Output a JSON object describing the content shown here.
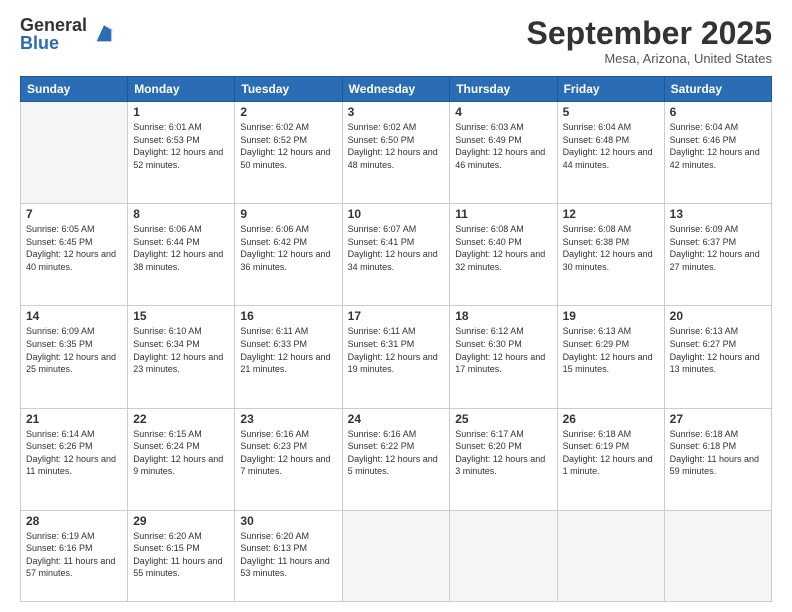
{
  "logo": {
    "general": "General",
    "blue": "Blue"
  },
  "header": {
    "month": "September 2025",
    "location": "Mesa, Arizona, United States"
  },
  "weekdays": [
    "Sunday",
    "Monday",
    "Tuesday",
    "Wednesday",
    "Thursday",
    "Friday",
    "Saturday"
  ],
  "weeks": [
    [
      {
        "day": "",
        "sunrise": "",
        "sunset": "",
        "daylight": ""
      },
      {
        "day": "1",
        "sunrise": "Sunrise: 6:01 AM",
        "sunset": "Sunset: 6:53 PM",
        "daylight": "Daylight: 12 hours and 52 minutes."
      },
      {
        "day": "2",
        "sunrise": "Sunrise: 6:02 AM",
        "sunset": "Sunset: 6:52 PM",
        "daylight": "Daylight: 12 hours and 50 minutes."
      },
      {
        "day": "3",
        "sunrise": "Sunrise: 6:02 AM",
        "sunset": "Sunset: 6:50 PM",
        "daylight": "Daylight: 12 hours and 48 minutes."
      },
      {
        "day": "4",
        "sunrise": "Sunrise: 6:03 AM",
        "sunset": "Sunset: 6:49 PM",
        "daylight": "Daylight: 12 hours and 46 minutes."
      },
      {
        "day": "5",
        "sunrise": "Sunrise: 6:04 AM",
        "sunset": "Sunset: 6:48 PM",
        "daylight": "Daylight: 12 hours and 44 minutes."
      },
      {
        "day": "6",
        "sunrise": "Sunrise: 6:04 AM",
        "sunset": "Sunset: 6:46 PM",
        "daylight": "Daylight: 12 hours and 42 minutes."
      }
    ],
    [
      {
        "day": "7",
        "sunrise": "Sunrise: 6:05 AM",
        "sunset": "Sunset: 6:45 PM",
        "daylight": "Daylight: 12 hours and 40 minutes."
      },
      {
        "day": "8",
        "sunrise": "Sunrise: 6:06 AM",
        "sunset": "Sunset: 6:44 PM",
        "daylight": "Daylight: 12 hours and 38 minutes."
      },
      {
        "day": "9",
        "sunrise": "Sunrise: 6:06 AM",
        "sunset": "Sunset: 6:42 PM",
        "daylight": "Daylight: 12 hours and 36 minutes."
      },
      {
        "day": "10",
        "sunrise": "Sunrise: 6:07 AM",
        "sunset": "Sunset: 6:41 PM",
        "daylight": "Daylight: 12 hours and 34 minutes."
      },
      {
        "day": "11",
        "sunrise": "Sunrise: 6:08 AM",
        "sunset": "Sunset: 6:40 PM",
        "daylight": "Daylight: 12 hours and 32 minutes."
      },
      {
        "day": "12",
        "sunrise": "Sunrise: 6:08 AM",
        "sunset": "Sunset: 6:38 PM",
        "daylight": "Daylight: 12 hours and 30 minutes."
      },
      {
        "day": "13",
        "sunrise": "Sunrise: 6:09 AM",
        "sunset": "Sunset: 6:37 PM",
        "daylight": "Daylight: 12 hours and 27 minutes."
      }
    ],
    [
      {
        "day": "14",
        "sunrise": "Sunrise: 6:09 AM",
        "sunset": "Sunset: 6:35 PM",
        "daylight": "Daylight: 12 hours and 25 minutes."
      },
      {
        "day": "15",
        "sunrise": "Sunrise: 6:10 AM",
        "sunset": "Sunset: 6:34 PM",
        "daylight": "Daylight: 12 hours and 23 minutes."
      },
      {
        "day": "16",
        "sunrise": "Sunrise: 6:11 AM",
        "sunset": "Sunset: 6:33 PM",
        "daylight": "Daylight: 12 hours and 21 minutes."
      },
      {
        "day": "17",
        "sunrise": "Sunrise: 6:11 AM",
        "sunset": "Sunset: 6:31 PM",
        "daylight": "Daylight: 12 hours and 19 minutes."
      },
      {
        "day": "18",
        "sunrise": "Sunrise: 6:12 AM",
        "sunset": "Sunset: 6:30 PM",
        "daylight": "Daylight: 12 hours and 17 minutes."
      },
      {
        "day": "19",
        "sunrise": "Sunrise: 6:13 AM",
        "sunset": "Sunset: 6:29 PM",
        "daylight": "Daylight: 12 hours and 15 minutes."
      },
      {
        "day": "20",
        "sunrise": "Sunrise: 6:13 AM",
        "sunset": "Sunset: 6:27 PM",
        "daylight": "Daylight: 12 hours and 13 minutes."
      }
    ],
    [
      {
        "day": "21",
        "sunrise": "Sunrise: 6:14 AM",
        "sunset": "Sunset: 6:26 PM",
        "daylight": "Daylight: 12 hours and 11 minutes."
      },
      {
        "day": "22",
        "sunrise": "Sunrise: 6:15 AM",
        "sunset": "Sunset: 6:24 PM",
        "daylight": "Daylight: 12 hours and 9 minutes."
      },
      {
        "day": "23",
        "sunrise": "Sunrise: 6:16 AM",
        "sunset": "Sunset: 6:23 PM",
        "daylight": "Daylight: 12 hours and 7 minutes."
      },
      {
        "day": "24",
        "sunrise": "Sunrise: 6:16 AM",
        "sunset": "Sunset: 6:22 PM",
        "daylight": "Daylight: 12 hours and 5 minutes."
      },
      {
        "day": "25",
        "sunrise": "Sunrise: 6:17 AM",
        "sunset": "Sunset: 6:20 PM",
        "daylight": "Daylight: 12 hours and 3 minutes."
      },
      {
        "day": "26",
        "sunrise": "Sunrise: 6:18 AM",
        "sunset": "Sunset: 6:19 PM",
        "daylight": "Daylight: 12 hours and 1 minute."
      },
      {
        "day": "27",
        "sunrise": "Sunrise: 6:18 AM",
        "sunset": "Sunset: 6:18 PM",
        "daylight": "Daylight: 11 hours and 59 minutes."
      }
    ],
    [
      {
        "day": "28",
        "sunrise": "Sunrise: 6:19 AM",
        "sunset": "Sunset: 6:16 PM",
        "daylight": "Daylight: 11 hours and 57 minutes."
      },
      {
        "day": "29",
        "sunrise": "Sunrise: 6:20 AM",
        "sunset": "Sunset: 6:15 PM",
        "daylight": "Daylight: 11 hours and 55 minutes."
      },
      {
        "day": "30",
        "sunrise": "Sunrise: 6:20 AM",
        "sunset": "Sunset: 6:13 PM",
        "daylight": "Daylight: 11 hours and 53 minutes."
      },
      {
        "day": "",
        "sunrise": "",
        "sunset": "",
        "daylight": ""
      },
      {
        "day": "",
        "sunrise": "",
        "sunset": "",
        "daylight": ""
      },
      {
        "day": "",
        "sunrise": "",
        "sunset": "",
        "daylight": ""
      },
      {
        "day": "",
        "sunrise": "",
        "sunset": "",
        "daylight": ""
      }
    ]
  ]
}
